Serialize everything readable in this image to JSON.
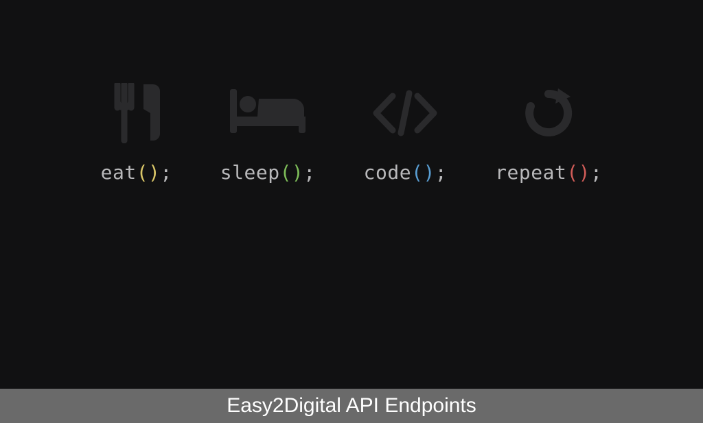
{
  "items": [
    {
      "word": "eat",
      "open": "(",
      "close": ")",
      "semi": ";",
      "parenClass": "paren-yellow"
    },
    {
      "word": "sleep",
      "open": "(",
      "close": ")",
      "semi": ";",
      "parenClass": "paren-green"
    },
    {
      "word": "code",
      "open": "(",
      "close": ")",
      "semi": ";",
      "parenClass": "paren-blue"
    },
    {
      "word": "repeat",
      "open": "(",
      "close": ")",
      "semi": ";",
      "parenClass": "paren-red"
    }
  ],
  "footer": {
    "title": "Easy2Digital API Endpoints"
  },
  "colors": {
    "bg": "#111112",
    "iconFill": "#2a2a2c",
    "text": "#b9b9bb",
    "footerBg": "#6a6a6a",
    "footerText": "#ffffff"
  }
}
